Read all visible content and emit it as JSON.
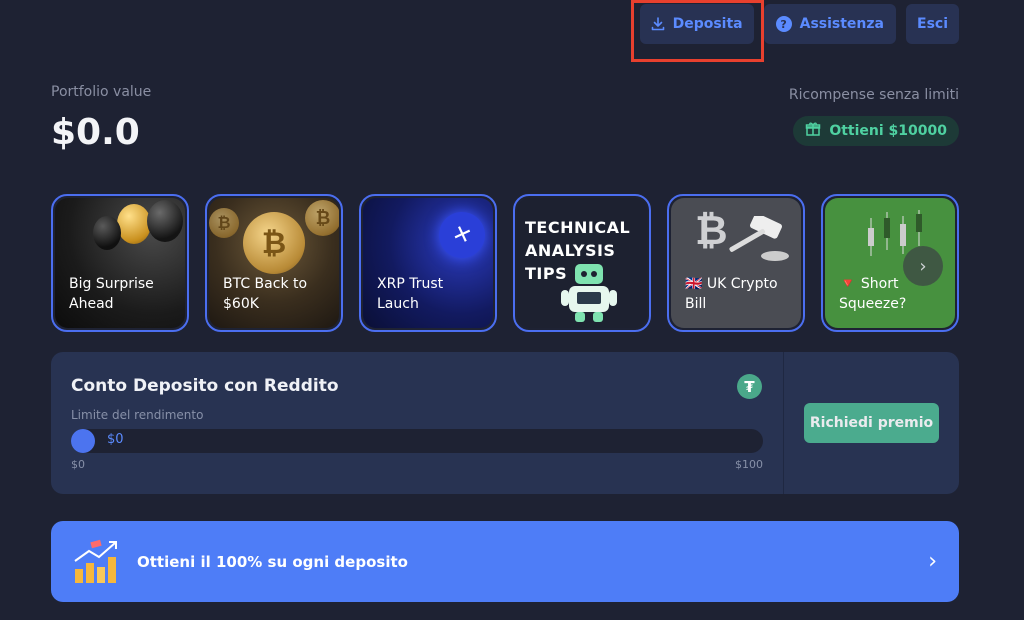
{
  "header": {
    "deposit_label": "Deposita",
    "help_label": "Assistenza",
    "logout_label": "Esci"
  },
  "portfolio": {
    "label": "Portfolio value",
    "value": "$0.0"
  },
  "rewards": {
    "label": "Ricompense senza limiti",
    "button_label": "Ottieni $10000"
  },
  "stories": [
    {
      "label": "Big Surprise\nAhead"
    },
    {
      "label": "BTC Back to\n$60K"
    },
    {
      "label": "XRP Trust\nLauch"
    },
    {
      "title": "TECHNICAL\nANALYSIS\nTIPS"
    },
    {
      "label": "🇬🇧 UK Crypto\nBill"
    },
    {
      "label": "🔻 Short\nSqueeze?"
    }
  ],
  "deposit_account": {
    "title": "Conto Deposito con Reddito",
    "subtitle": "Limite del rendimento",
    "current_value": "$0",
    "min": "$0",
    "max": "$100",
    "progress": 0,
    "claim_label": "Richiedi premio"
  },
  "promo": {
    "text": "Ottieni il 100% su ogni deposito"
  },
  "colors": {
    "background": "#1e2233",
    "accent": "#5b8bff",
    "green": "#4fb895",
    "highlight": "#e8402e"
  }
}
